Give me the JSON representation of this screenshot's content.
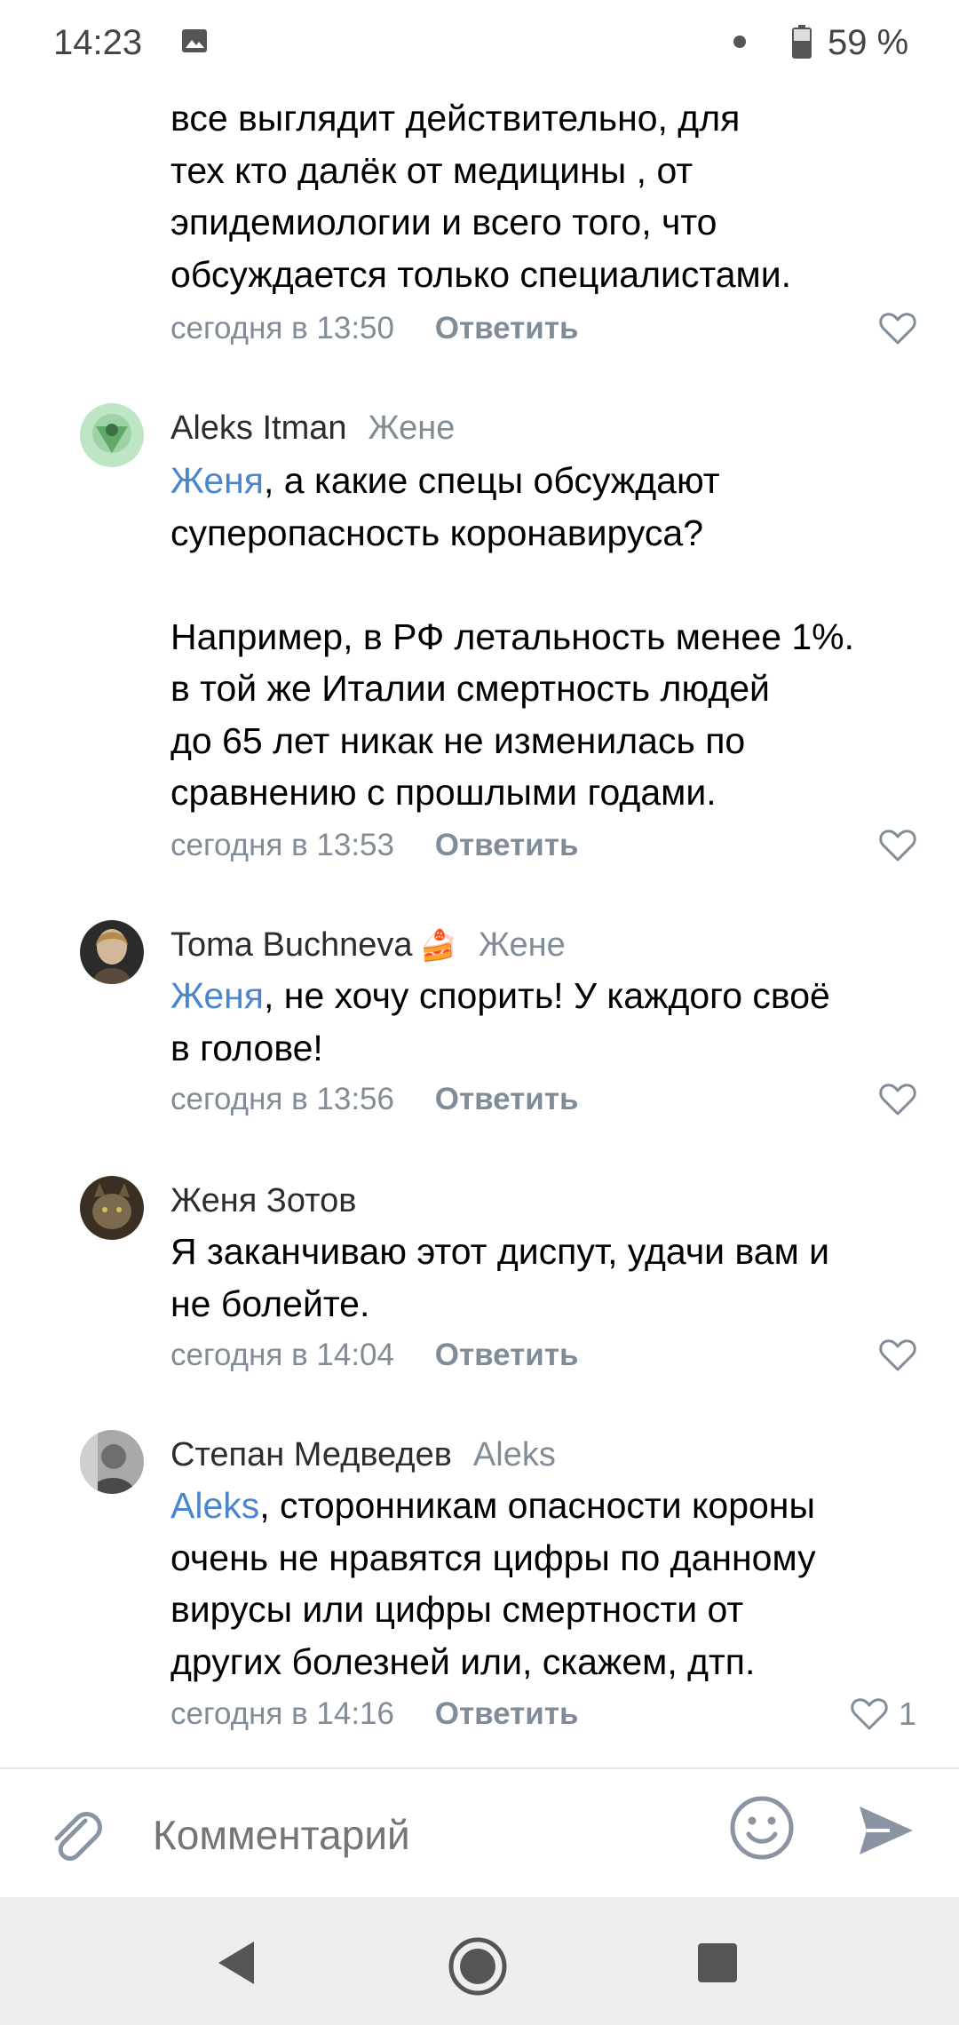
{
  "status_bar": {
    "time": "14:23",
    "battery": "59 %"
  },
  "comments": [
    {
      "author": "",
      "reply_to": "",
      "mention": "",
      "text": "все выглядит действительно, для\nтех кто далёк от медицины , от\nэпидемиологии и всего того, что\nобсуждается только специалистами.",
      "date": "сегодня в 13:50",
      "reply_label": "Ответить",
      "likes": ""
    },
    {
      "author": "Aleks Itman",
      "reply_to": "Жене",
      "mention": "Женя",
      "text": ", а какие спецы обсуждают\nсуперопасность коронавируса?\n\nНапример, в РФ летальность менее 1%.\nв той же Италии смертность людей\nдо 65 лет никак не изменилась по\nсравнению с прошлыми годами.",
      "date": "сегодня в 13:53",
      "reply_label": "Ответить",
      "likes": ""
    },
    {
      "author": "Toma Buchneva",
      "author_emoji": "🍰",
      "reply_to": "Жене",
      "mention": "Женя",
      "text": ", не хочу спорить! У каждого своё\nв голове!",
      "date": "сегодня в 13:56",
      "reply_label": "Ответить",
      "likes": ""
    },
    {
      "author": "Женя Зотов",
      "reply_to": "",
      "mention": "",
      "text": "Я заканчиваю этот диспут, удачи вам и\nне болейте.",
      "date": "сегодня в 14:04",
      "reply_label": "Ответить",
      "likes": ""
    },
    {
      "author": "Степан Медведев",
      "reply_to": "Aleks",
      "mention": "Aleks",
      "text": ", сторонникам опасности короны\nочень не нравятся цифры по данному\nвирусы или цифры смертности от\nдругих болезней или, скажем, дтп.",
      "date": "сегодня в 14:16",
      "reply_label": "Ответить",
      "likes": "1"
    }
  ],
  "input": {
    "placeholder": "Комментарий"
  },
  "icons": {
    "attach": "paperclip-icon",
    "emoji": "smile-icon",
    "send": "send-icon",
    "like": "heart-icon",
    "nav_back": "back-triangle-icon",
    "nav_home": "home-circle-icon",
    "nav_recent": "recent-square-icon"
  },
  "colors": {
    "accent": "#4a86cf",
    "secondary_text": "#818c99",
    "like": "#818c99"
  }
}
